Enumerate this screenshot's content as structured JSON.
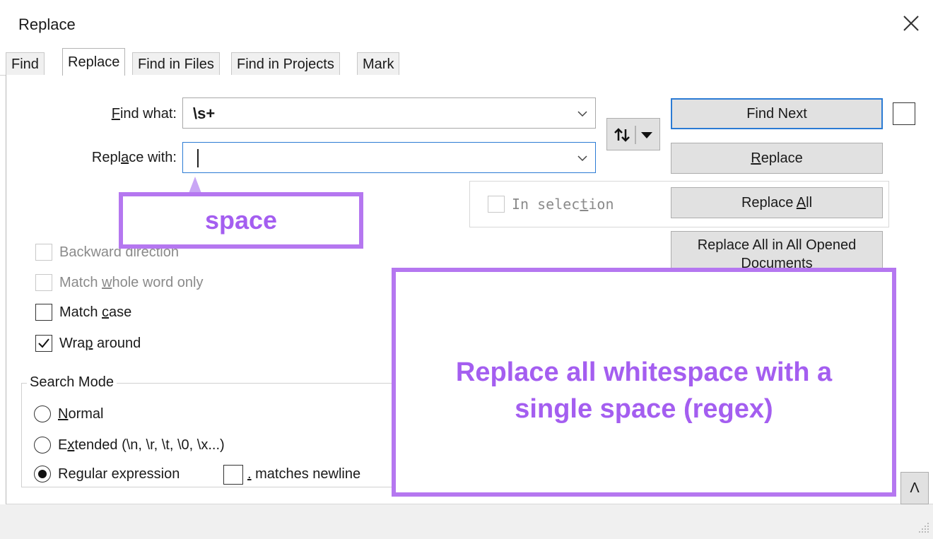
{
  "window": {
    "title": "Replace",
    "close_icon": "close-icon"
  },
  "tabs": [
    {
      "label": "Find"
    },
    {
      "label": "Replace",
      "active": true
    },
    {
      "label": "Find in Files"
    },
    {
      "label": "Find in Projects"
    },
    {
      "label": "Mark"
    }
  ],
  "find_what": {
    "label_pre": "",
    "label_u": "F",
    "label_post": "ind what:",
    "value": "\\s+"
  },
  "replace_with": {
    "label_pre": "Repl",
    "label_u": "a",
    "label_post": "ce with:",
    "value": ""
  },
  "buttons": {
    "find_next": "Find Next",
    "replace": {
      "u": "R",
      "post": "eplace"
    },
    "replace_all": {
      "pre": "Replace ",
      "u": "A",
      "post": "ll"
    },
    "replace_all_opened_line1": "Replace All in All Opened",
    "replace_all_opened_line2": "Documents",
    "collapse": "Λ"
  },
  "in_selection": {
    "pre": "In selec",
    "u": "t",
    "post": "ion",
    "checked": false
  },
  "options": {
    "backward": {
      "label": "Backward direction",
      "checked": false,
      "disabled": true
    },
    "whole_word": {
      "pre": "Match ",
      "u": "w",
      "post": "hole word only",
      "checked": false,
      "disabled": true
    },
    "match_case": {
      "pre": "Match ",
      "u": "c",
      "post": "ase",
      "checked": false
    },
    "wrap": {
      "pre": "Wra",
      "u": "p",
      "post": " around",
      "checked": true
    }
  },
  "search_mode": {
    "title": "Search Mode",
    "normal": {
      "u": "N",
      "post": "ormal",
      "selected": false
    },
    "extended": {
      "pre": "E",
      "u": "x",
      "post": "tended (\\n, \\r, \\t, \\0, \\x...)",
      "selected": false
    },
    "regex": {
      "label": "Regular expression",
      "selected": true
    },
    "dot_newline": {
      "u": ".",
      "post": " matches newline",
      "checked": false
    }
  },
  "annotations": {
    "space_note": "space",
    "main_note_line1": "Replace all whitespace with a",
    "main_note_line2": "single space (regex)"
  },
  "colors": {
    "accent": "#2b7bd4",
    "annotation": "#a45ef0"
  }
}
